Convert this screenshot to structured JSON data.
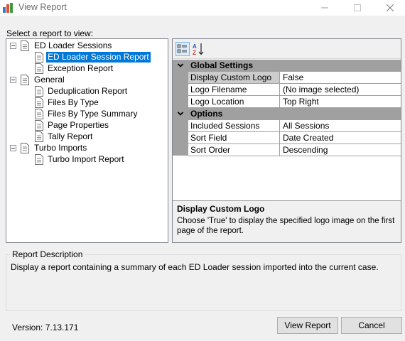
{
  "window": {
    "title": "View Report"
  },
  "select_label": "Select a report to view:",
  "tree": {
    "groups": [
      {
        "label": "ED Loader Sessions",
        "children": [
          "ED Loader Session Report",
          "Exception Report"
        ]
      },
      {
        "label": "General",
        "children": [
          "Deduplication Report",
          "Files By Type",
          "Files By Type Summary",
          "Page Properties",
          "Tally Report"
        ]
      },
      {
        "label": "Turbo Imports",
        "children": [
          "Turbo Import Report"
        ]
      }
    ],
    "selected": "ED Loader Session Report"
  },
  "property_grid": {
    "categories": [
      {
        "label": "Global Settings",
        "rows": [
          {
            "name": "Display Custom Logo",
            "value": "False"
          },
          {
            "name": "Logo Filename",
            "value": "(No image selected)"
          },
          {
            "name": "Logo Location",
            "value": "Top Right"
          }
        ]
      },
      {
        "label": "Options",
        "rows": [
          {
            "name": "Included Sessions",
            "value": "All Sessions"
          },
          {
            "name": "Sort Field",
            "value": "Date Created"
          },
          {
            "name": "Sort Order",
            "value": "Descending"
          }
        ]
      }
    ],
    "selected_property": "Display Custom Logo",
    "help": {
      "title": "Display Custom Logo",
      "text": "Choose 'True' to display the specified logo image on the first page of the report."
    }
  },
  "report_description": {
    "legend": "Report Description",
    "text": "Display a report containing a summary of each ED Loader session imported into the current case."
  },
  "version": "Version: 7.13.171",
  "buttons": {
    "view": "View Report",
    "cancel": "Cancel"
  },
  "colors": {
    "selection": "#0078d7",
    "category_bg": "#a0a0a0",
    "window_bg": "#f0f0f0"
  }
}
